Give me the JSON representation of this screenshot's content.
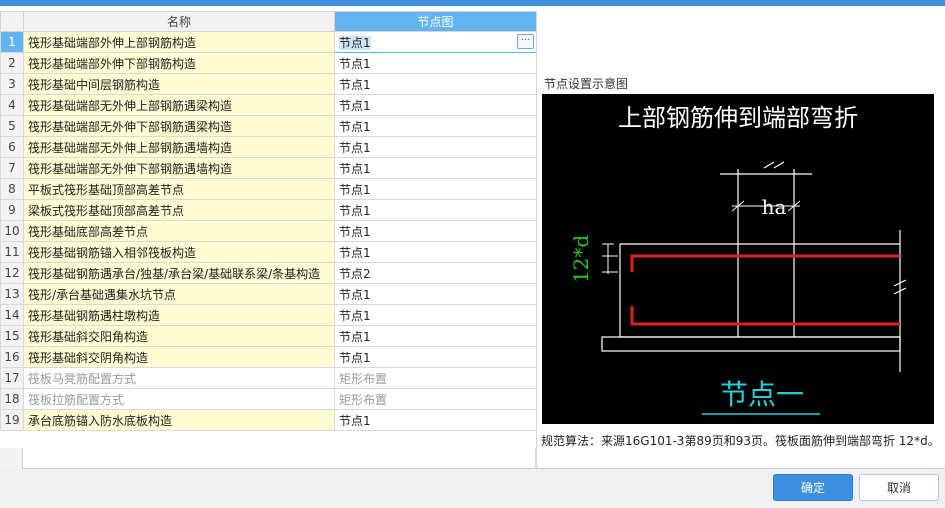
{
  "table": {
    "columns": {
      "name": "名称",
      "node_diagram": "节点图"
    },
    "rows": [
      {
        "index": "1",
        "name": "筏形基础端部外伸上部钢筋构造",
        "value": "节点1"
      },
      {
        "index": "2",
        "name": "筏形基础端部外伸下部钢筋构造",
        "value": "节点1"
      },
      {
        "index": "3",
        "name": "筏形基础中间层钢筋构造",
        "value": "节点1"
      },
      {
        "index": "4",
        "name": "筏形基础端部无外伸上部钢筋遇梁构造",
        "value": "节点1"
      },
      {
        "index": "5",
        "name": "筏形基础端部无外伸下部钢筋遇梁构造",
        "value": "节点1"
      },
      {
        "index": "6",
        "name": "筏形基础端部无外伸上部钢筋遇墙构造",
        "value": "节点1"
      },
      {
        "index": "7",
        "name": "筏形基础端部无外伸下部钢筋遇墙构造",
        "value": "节点1"
      },
      {
        "index": "8",
        "name": "平板式筏形基础顶部高差节点",
        "value": "节点1"
      },
      {
        "index": "9",
        "name": "梁板式筏形基础顶部高差节点",
        "value": "节点1"
      },
      {
        "index": "10",
        "name": "筏形基础底部高差节点",
        "value": "节点1"
      },
      {
        "index": "11",
        "name": "筏形基础钢筋锚入相邻筏板构造",
        "value": "节点1"
      },
      {
        "index": "12",
        "name": "筏形基础钢筋遇承台/独基/承台梁/基础联系梁/条基构造",
        "value": "节点2"
      },
      {
        "index": "13",
        "name": "筏形/承台基础遇集水坑节点",
        "value": "节点1"
      },
      {
        "index": "14",
        "name": "筏形基础钢筋遇柱墩构造",
        "value": "节点1"
      },
      {
        "index": "15",
        "name": "筏形基础斜交阳角构造",
        "value": "节点1"
      },
      {
        "index": "16",
        "name": "筏形基础斜交阴角构造",
        "value": "节点1"
      },
      {
        "index": "17",
        "name": "筏板马凳筋配置方式",
        "value": "矩形布置"
      },
      {
        "index": "18",
        "name": "筏板拉筋配置方式",
        "value": "矩形布置"
      },
      {
        "index": "19",
        "name": "承台底筋锚入防水底板构造",
        "value": "节点1"
      }
    ]
  },
  "panel": {
    "title": "节点设置示意图",
    "diagram": {
      "heading": "上部钢筋伸到端部弯折",
      "ha_label": "ha",
      "bend_label": "12*d",
      "node_label": "节点一"
    },
    "rule_text": "规范算法：来源16G101-3第89页和93页。筏板面筋伸到端部弯折 12*d。"
  },
  "buttons": {
    "ok": "确定",
    "cancel": "取消"
  },
  "colors": {
    "accent": "#3d8fe0",
    "name_cell": "#fffbd2",
    "header_selected": "#64b4f0",
    "rebar": "#e02020",
    "dim_green": "#22cc22",
    "node_cyan": "#22d0d8"
  }
}
